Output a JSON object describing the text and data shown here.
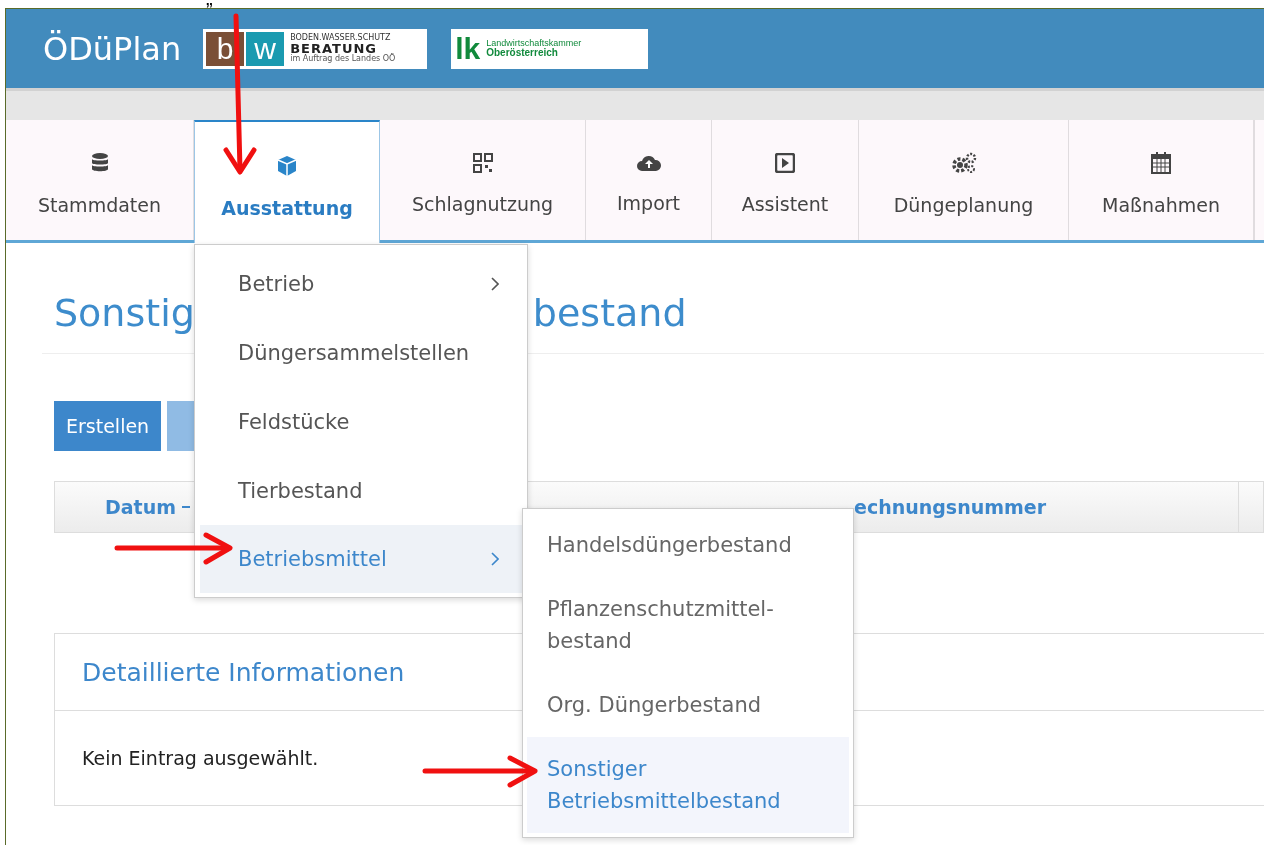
{
  "caption": "„",
  "header": {
    "app_name": "ÖDüPlan",
    "logos": [
      {
        "kind": "bw",
        "mark_left": "b",
        "mark_right": "w",
        "lines": [
          "BODEN.WASSER.SCHUTZ",
          "BERATUNG",
          "im Auftrag des Landes OÖ"
        ]
      },
      {
        "kind": "lk",
        "mark": "lk",
        "lines": [
          "Landwirtschaftskammer",
          "Oberösterreich"
        ]
      }
    ]
  },
  "tabs": [
    {
      "label": "Stammdaten",
      "selected": false
    },
    {
      "label": "Ausstattung",
      "selected": true
    },
    {
      "label": "Schlagnutzung",
      "selected": false
    },
    {
      "label": "Import",
      "selected": false
    },
    {
      "label": "Assistent",
      "selected": false
    },
    {
      "label": "Düngeplanung",
      "selected": false
    },
    {
      "label": "Maßnahmen",
      "selected": false
    }
  ],
  "page": {
    "title_parts": [
      "Sonstig",
      "bestand"
    ],
    "buttons": [
      {
        "label": "Erstellen"
      },
      {
        "kind": "blank"
      }
    ],
    "table": {
      "columns": [
        {
          "label": "Datum"
        },
        {
          "label": "echnungsnummer"
        }
      ]
    },
    "detail_panel": {
      "title": "Detaillierte Informationen",
      "body": "Kein Eintrag ausgewählt."
    }
  },
  "menu": {
    "items": [
      {
        "label": "Betrieb",
        "has_submenu": true,
        "selected": false
      },
      {
        "label": "Düngersammelstellen",
        "has_submenu": false,
        "selected": false
      },
      {
        "label": "Feldstücke",
        "has_submenu": false,
        "selected": false
      },
      {
        "label": "Tierbestand",
        "has_submenu": false,
        "selected": false
      },
      {
        "label": "Betriebsmittel",
        "has_submenu": true,
        "selected": true
      }
    ]
  },
  "submenu": {
    "items": [
      {
        "label": "Handelsdüngerbestand",
        "selected": false
      },
      {
        "label": "Pflanzenschutzmittel-bestand",
        "selected": false
      },
      {
        "label": "Org. Düngerbestand",
        "selected": false
      },
      {
        "label": "Sonstiger Betriebsmittelbestand",
        "selected": true
      }
    ]
  }
}
